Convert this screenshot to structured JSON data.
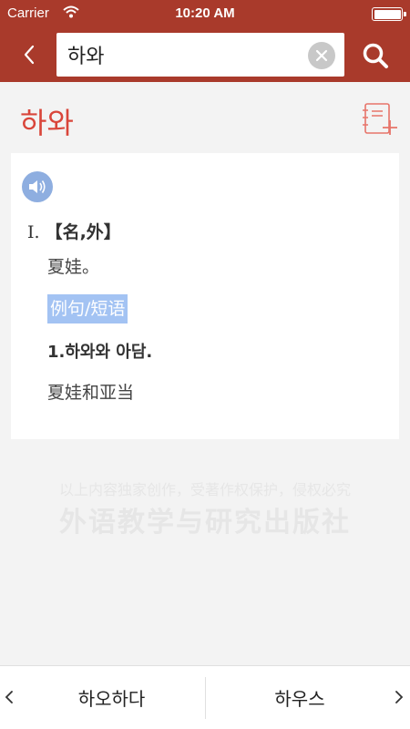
{
  "status_bar": {
    "carrier": "Carrier",
    "time": "10:20 AM"
  },
  "search": {
    "query": "하와"
  },
  "entry": {
    "headword": "하와",
    "senses": [
      {
        "number": "Ⅰ.",
        "pos": "【名,外】",
        "definition": "夏娃。"
      }
    ],
    "examples_label": "例句/短语",
    "examples": [
      {
        "korean": "1.하와와 아담.",
        "chinese": "夏娃和亚当"
      }
    ]
  },
  "watermark": {
    "line1": "以上内容独家创作，受著作权保护，侵权必究",
    "line2": "外语教学与研究出版社"
  },
  "bottom_nav": {
    "prev_word": "하오하다",
    "next_word": "하우스"
  },
  "colors": {
    "brand_red": "#a93a2b",
    "headword_red": "#d9453a",
    "speaker_blue": "#8eaee0",
    "tag_blue": "#a3c3f3"
  },
  "icons": {
    "back": "chevron-left-icon",
    "clear": "clear-icon",
    "search": "search-icon",
    "notebook": "add-to-notebook-icon",
    "speaker": "speaker-icon",
    "prev": "chevron-left-icon",
    "next": "chevron-right-icon"
  }
}
